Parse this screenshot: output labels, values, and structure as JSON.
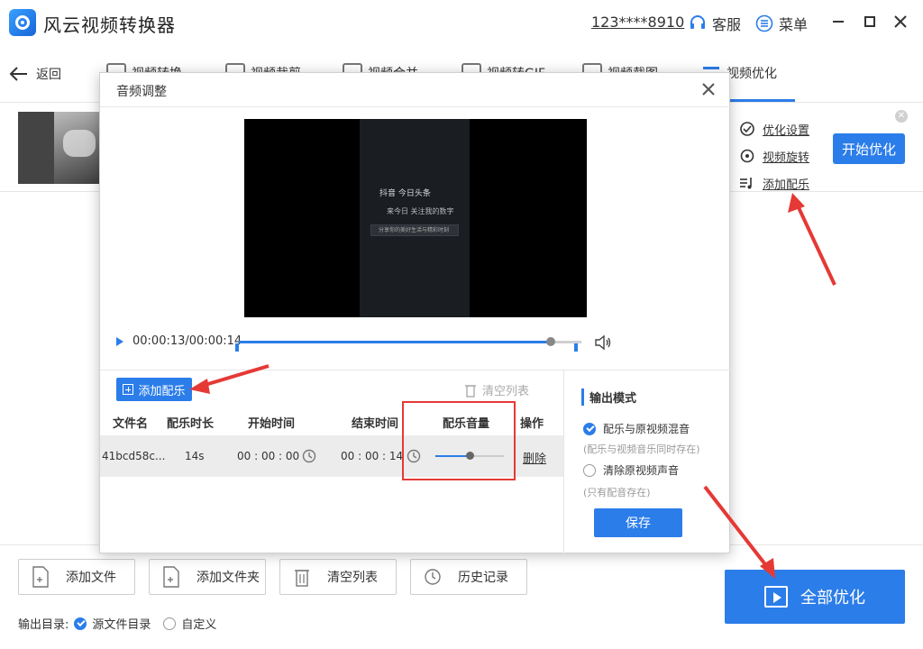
{
  "app": {
    "title": "风云视频转换器",
    "account": "123****8910",
    "service_label": "客服",
    "menu_label": "菜单"
  },
  "nav": {
    "back_label": "返回",
    "tabs": [
      {
        "label": "视频转换"
      },
      {
        "label": "视频裁剪"
      },
      {
        "label": "视频合并"
      },
      {
        "label": "视频转GIF"
      },
      {
        "label": "视频截图"
      },
      {
        "label": "视频优化"
      }
    ]
  },
  "right_panel": {
    "options": [
      "优化设置",
      "视频旋转",
      "添加配乐"
    ],
    "start_button": "开始优化"
  },
  "bottom": {
    "buttons": [
      "添加文件",
      "添加文件夹",
      "清空列表",
      "历史记录"
    ],
    "output_label": "输出目录:",
    "output_options": [
      "源文件目录",
      "自定义"
    ],
    "optimize_all": "全部优化"
  },
  "modal": {
    "title": "音频调整",
    "video_overlay": {
      "brand": "抖音  今日头条",
      "tagline": "来今日 关注我的数字",
      "search_text": "分享你的美好生活与精彩时刻"
    },
    "timecode": "00:00:13/00:00:14",
    "playback_progress": 0.91,
    "add_music": "添加配乐",
    "clear_list": "清空列表",
    "table": {
      "headers": [
        "文件名",
        "配乐时长",
        "开始时间",
        "结束时间",
        "配乐音量",
        "操作"
      ],
      "rows": [
        {
          "filename": "41bcd58c...",
          "duration": "14s",
          "start": "00 : 00 : 00",
          "end": "00 : 00 : 14",
          "volume": 0.5,
          "action": "删除"
        }
      ]
    },
    "output_mode": {
      "title": "输出模式",
      "options": [
        {
          "label": "配乐与原视频混音",
          "note": "(配乐与视频音乐同时存在)",
          "selected": true
        },
        {
          "label": "清除原视频声音",
          "note": "(只有配音存在)",
          "selected": false
        }
      ],
      "save": "保存"
    }
  },
  "colors": {
    "accent": "#2b7de9",
    "annotation": "#e53935"
  }
}
